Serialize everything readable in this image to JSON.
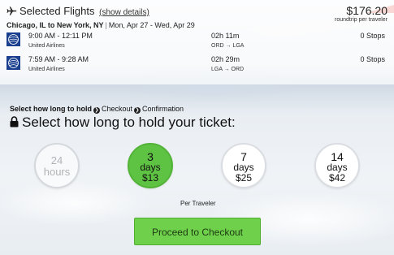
{
  "header": {
    "title": "Selected Flights",
    "details_link": "(show details)",
    "price": "$176.20",
    "price_note": "roundtrip per traveler",
    "route": "Chicago, IL to New York, NY",
    "dates": "Mon, Apr 27 - Wed, Apr 29"
  },
  "flights": [
    {
      "times": "9:00 AM - 12:11 PM",
      "airline": "United Airlines",
      "duration": "02h 11m",
      "airports": "ORD → LGA",
      "stops": "0 Stops"
    },
    {
      "times": "7:59 AM - 9:28 AM",
      "airline": "United Airlines",
      "duration": "02h 29m",
      "airports": "LGA → ORD",
      "stops": "0 Stops"
    }
  ],
  "steps": {
    "current": "Select how long to hold",
    "checkout": "Checkout",
    "confirmation": "Confirmation"
  },
  "heading": "Select how long to hold your ticket:",
  "hold_options": [
    {
      "amount": "24",
      "unit": "hours",
      "price": "",
      "state": "disabled"
    },
    {
      "amount": "3",
      "unit": "days",
      "price": "$13",
      "state": "selected"
    },
    {
      "amount": "7",
      "unit": "days",
      "price": "$25",
      "state": "default"
    },
    {
      "amount": "14",
      "unit": "days",
      "price": "$42",
      "state": "default"
    }
  ],
  "per_traveler": "Per Traveler",
  "cta_label": "Proceed to Checkout",
  "colors": {
    "accent_green": "#5ec242",
    "button_green": "#6fd04b",
    "airline_blue": "#1a3f8f"
  },
  "icons": {
    "plane": "plane-icon",
    "lock": "lock-icon",
    "airline": "united-logo-icon",
    "chevron": "chevron-right-icon"
  }
}
